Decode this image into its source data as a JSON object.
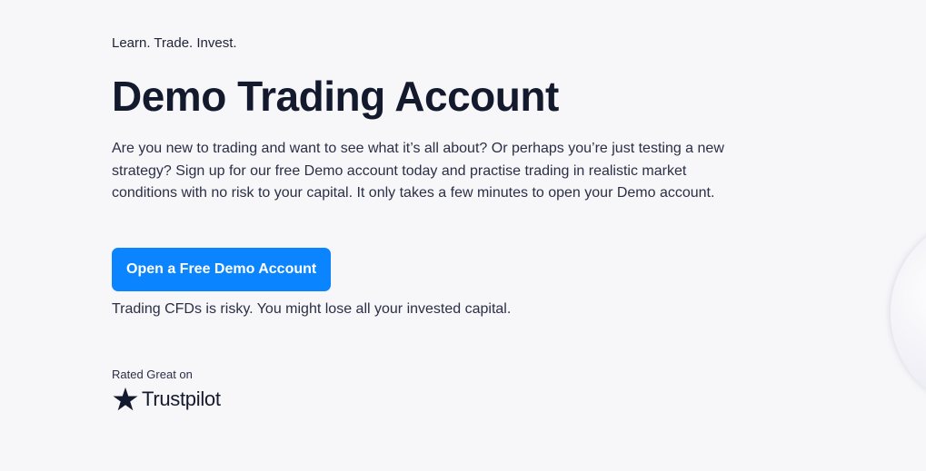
{
  "hero": {
    "tagline": "Learn. Trade. Invest.",
    "title": "Demo Trading Account",
    "intro": "Are you new to trading and want to see what it’s all about? Or perhaps you’re just testing a new strategy?  Sign up for our free Demo account today and practise trading in realistic market conditions with no risk to your capital. It only takes a few minutes to open your Demo account.",
    "cta_label": "Open a Free Demo Account",
    "risk_warning": "Trading CFDs is risky. You might lose all your invested capital."
  },
  "rating": {
    "label": "Rated Great on",
    "brand": "Trustpilot",
    "brand_icon": "star-icon"
  },
  "colors": {
    "background": "#f7f7fa",
    "accent": "#0a84ff",
    "heading": "#141a2e"
  }
}
